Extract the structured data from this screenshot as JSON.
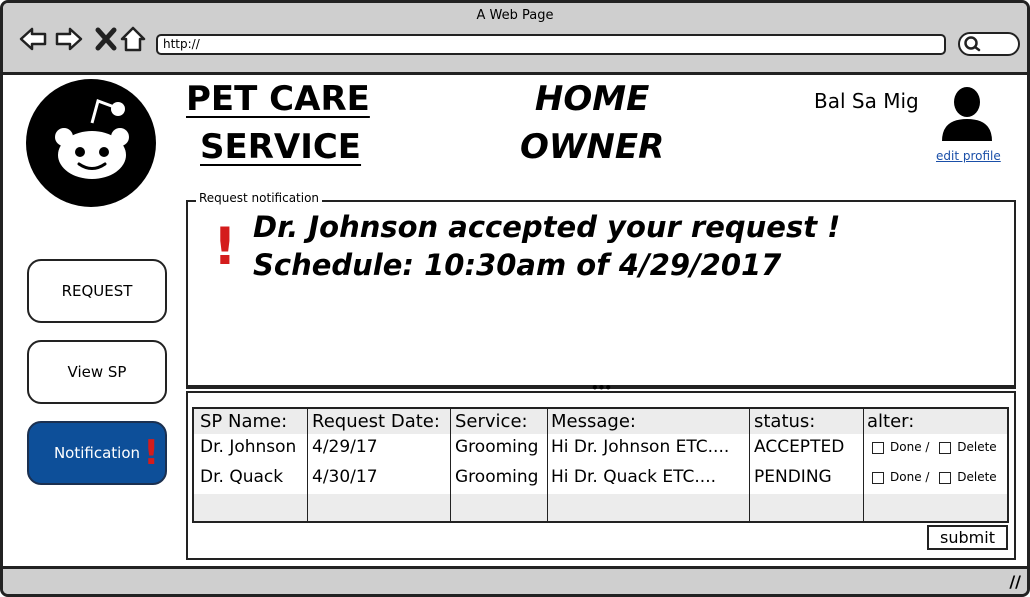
{
  "browser": {
    "window_title": "A Web Page",
    "url": "http://"
  },
  "header": {
    "brand_line1": "PET CARE",
    "brand_line2": "SERVICE",
    "page_line1": "HOME",
    "page_line2": "OWNER",
    "user_name": "Bal Sa Mig",
    "edit_profile": "edit profile"
  },
  "sidebar": {
    "items": [
      {
        "label": "REQUEST"
      },
      {
        "label": "View SP"
      },
      {
        "label": "Notification",
        "badge": "!"
      }
    ]
  },
  "notification": {
    "legend": "Request notification",
    "alert_mark": "!",
    "line1": "Dr. Johnson accepted your request !",
    "line2": "Schedule:  10:30am of 4/29/2017"
  },
  "table": {
    "headers": [
      "SP Name:",
      "Request Date:",
      "Service:",
      "Message:",
      "status:",
      "alter:"
    ],
    "rows": [
      {
        "sp_name": "Dr. Johnson",
        "date": "4/29/17",
        "service": "Grooming",
        "message": "Hi Dr. Johnson ETC....",
        "status": "ACCEPTED",
        "done": "Done /",
        "delete": "Delete"
      },
      {
        "sp_name": "Dr. Quack",
        "date": "4/30/17",
        "service": "Grooming",
        "message": "Hi Dr. Quack ETC....",
        "status": "PENDING",
        "done": "Done /",
        "delete": "Delete"
      }
    ],
    "submit_label": "submit"
  },
  "colors": {
    "active_button": "#0d4f99",
    "alert_red": "#d41c1c",
    "link_blue": "#1a4fa8"
  }
}
